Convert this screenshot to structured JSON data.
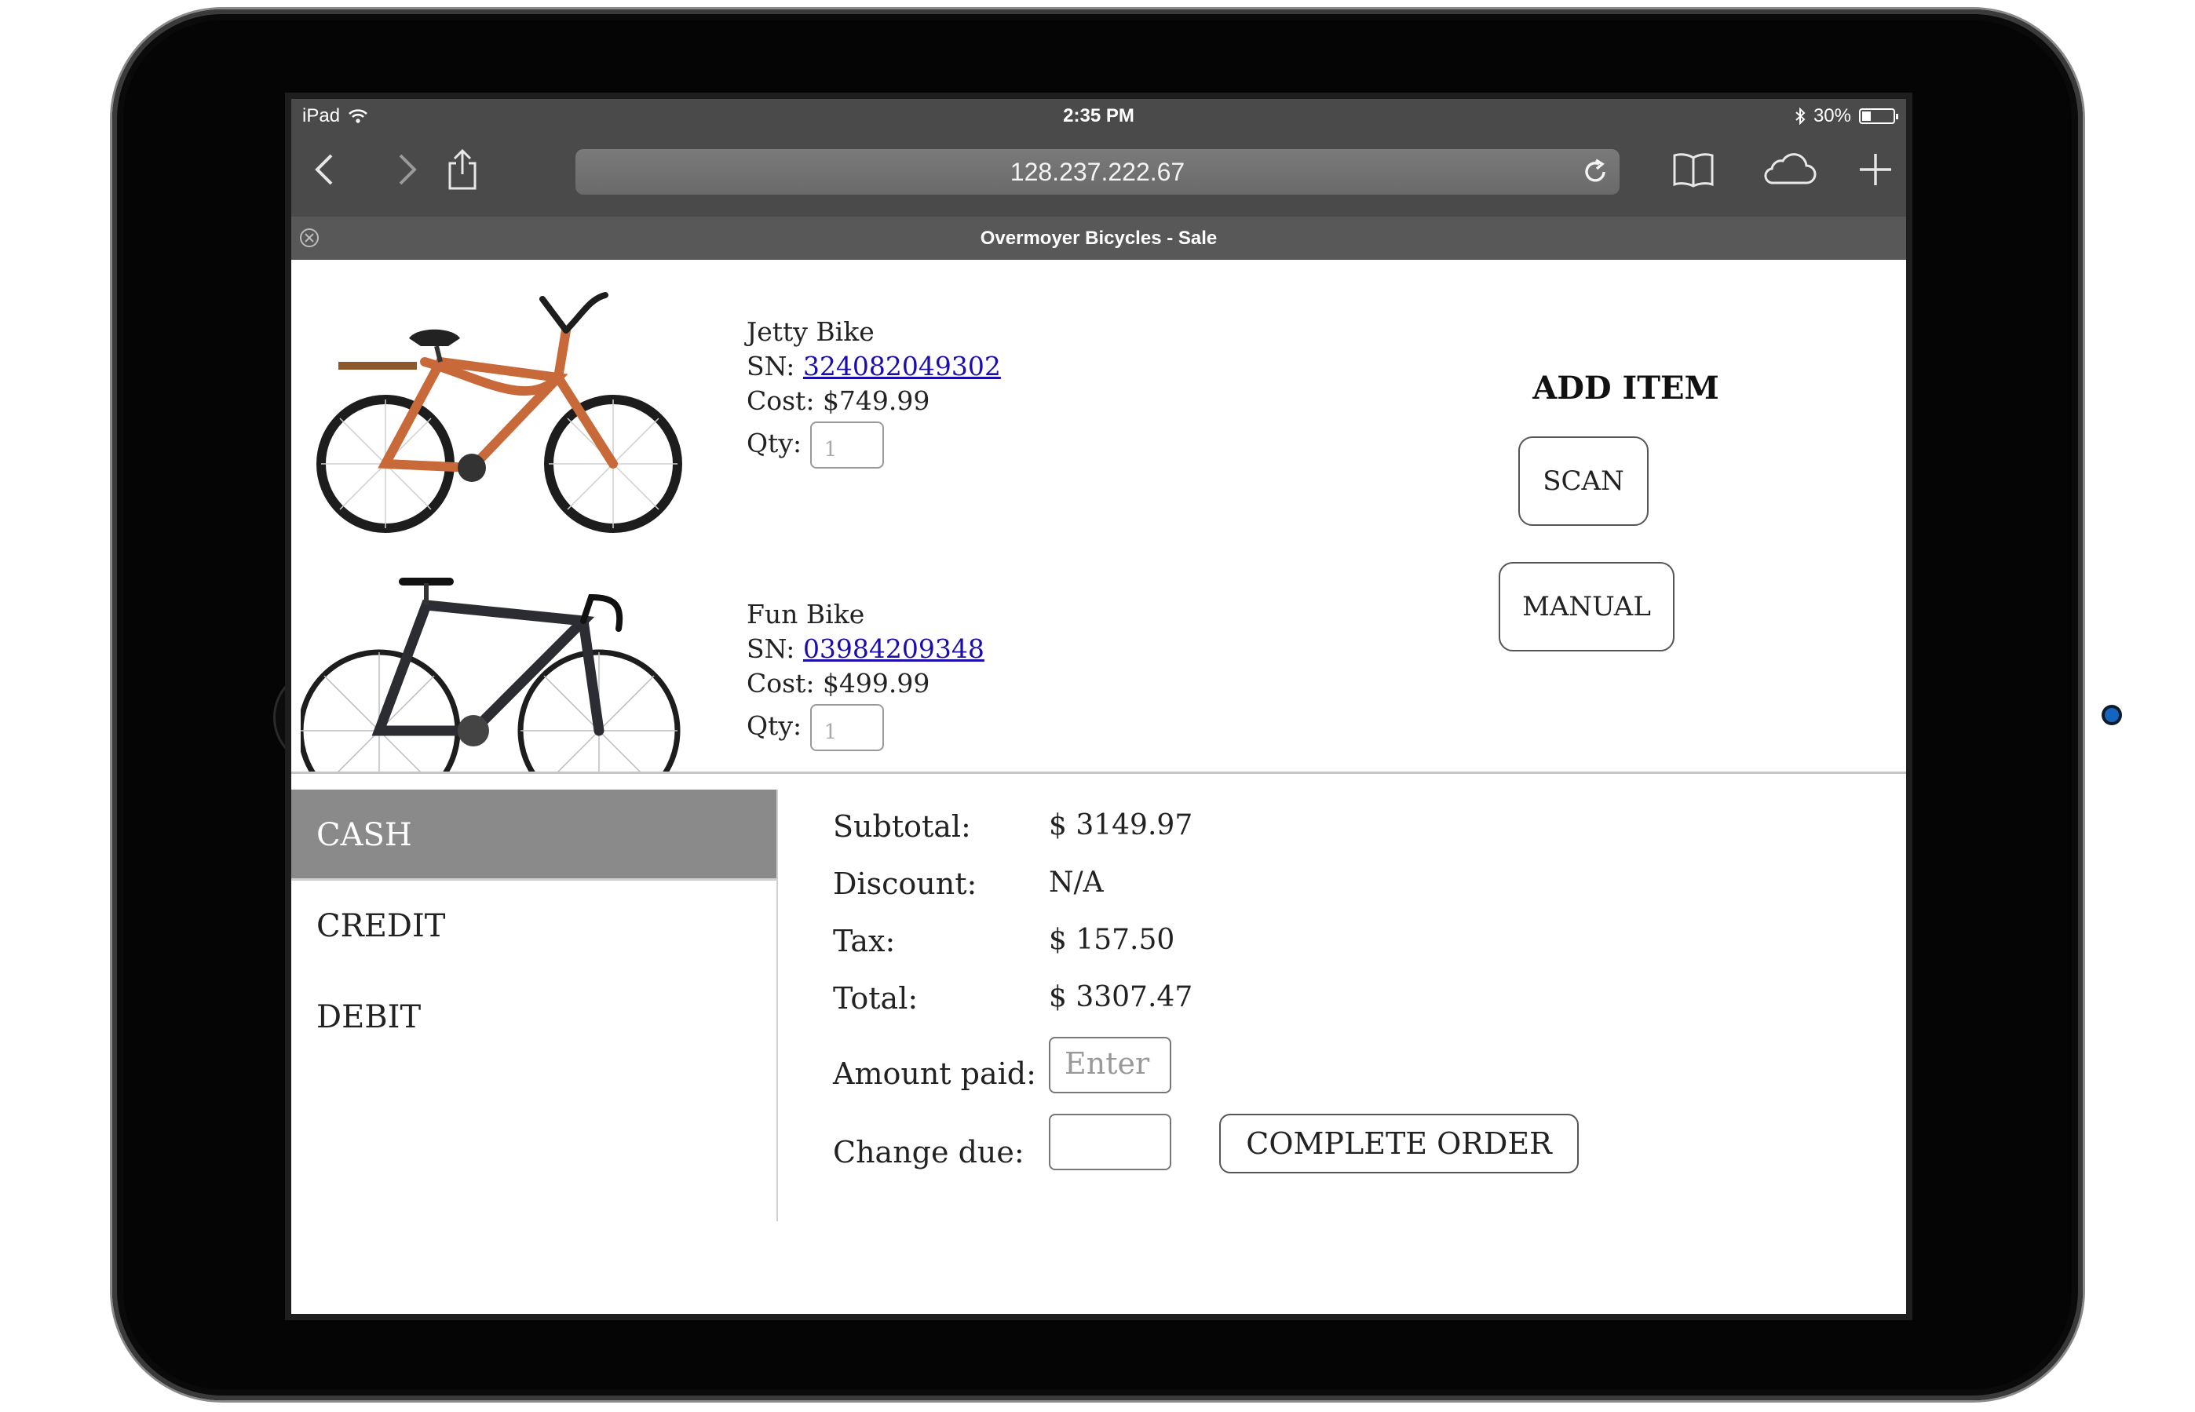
{
  "status_bar": {
    "device": "iPad",
    "time": "2:35 PM",
    "battery_percent": "30%",
    "battery_level": 0.3
  },
  "browser": {
    "url": "128.237.222.67",
    "tab_title": "Overmoyer Bicycles - Sale",
    "toolbar_icons": [
      "back-icon",
      "forward-icon",
      "share-icon",
      "reload-icon",
      "bookmarks-icon",
      "icloud-tabs-icon",
      "new-tab-icon"
    ]
  },
  "products": [
    {
      "name": "Jetty Bike",
      "sn_label": "SN:",
      "sn": "324082049302",
      "cost_label": "Cost:",
      "cost": "$749.99",
      "qty_label": "Qty:",
      "qty_placeholder": "1"
    },
    {
      "name": "Fun Bike",
      "sn_label": "SN:",
      "sn": "03984209348",
      "cost_label": "Cost:",
      "cost": "$499.99",
      "qty_label": "Qty:",
      "qty_placeholder": "1"
    }
  ],
  "add_item": {
    "title": "ADD ITEM",
    "scan_label": "SCAN",
    "manual_label": "MANUAL"
  },
  "payment_methods": [
    {
      "label": "CASH",
      "active": true
    },
    {
      "label": "CREDIT",
      "active": false
    },
    {
      "label": "DEBIT",
      "active": false
    }
  ],
  "totals": {
    "subtotal_label": "Subtotal:",
    "subtotal": "$ 3149.97",
    "discount_label": "Discount:",
    "discount": "N/A",
    "tax_label": "Tax:",
    "tax": "$ 157.50",
    "total_label": "Total:",
    "total": "$ 3307.47",
    "amount_paid_label": "Amount paid:",
    "amount_paid_placeholder": "Enter",
    "change_due_label": "Change due:",
    "change_due_value": "",
    "complete_order_label": "COMPLETE ORDER"
  },
  "colors": {
    "safari_bar": "#4a4a4a",
    "tab_bar": "#585858",
    "active_payment_tab": "#8a8a8a",
    "link": "#1a0dab",
    "jetty_bike": "#c8693a",
    "fun_bike": "#2b2d33"
  }
}
